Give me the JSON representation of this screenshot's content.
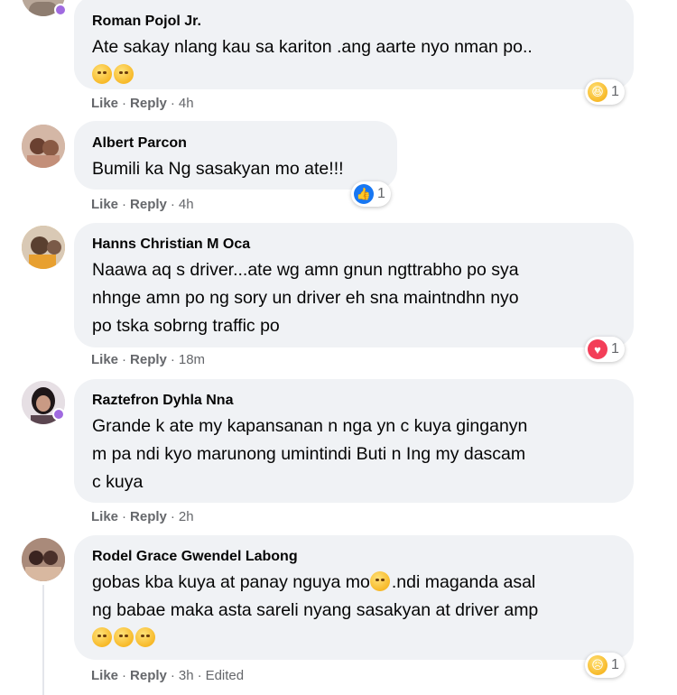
{
  "comments": [
    {
      "author": "Roman Pojol Jr.",
      "text": "Ate sakay nlang kau sa kariton .ang aarte nyo nman po..",
      "emojis": [
        "pensive-emoji",
        "pensive-emoji"
      ],
      "like": "Like",
      "reply": "Reply",
      "time": "4h",
      "reaction": {
        "icon": "haha-icon",
        "count": "1"
      }
    },
    {
      "author": "Albert Parcon",
      "text": "Bumili ka Ng sasakyan mo ate!!!",
      "like": "Like",
      "reply": "Reply",
      "time": "4h",
      "reaction": {
        "icon": "like-icon",
        "count": "1"
      }
    },
    {
      "author": "Hanns Christian M Oca",
      "text": "Naawa aq s driver...ate wg amn gnun ngttrabho po sya\nnhnge amn po ng sory un driver eh sna maintndhn nyo\npo tska sobrng traffic po",
      "like": "Like",
      "reply": "Reply",
      "time": "18m",
      "reaction": {
        "icon": "love-icon",
        "count": "1"
      }
    },
    {
      "author": "Raztefron Dyhla Nna",
      "text": "Grande k ate my kapansanan n nga yn c kuya ginganyn\nm pa ndi kyo marunong umintindi Buti n Ing my dascam\nc kuya",
      "like": "Like",
      "reply": "Reply",
      "time": "2h"
    },
    {
      "author": "Rodel Grace Gwendel Labong",
      "text_a": "gobas kba kuya at panay nguya mo",
      "text_b": ".ndi maganda asal\nng babae maka asta sareli nyang sasakyan at driver amp",
      "emojis": [
        "grin-emoji",
        "grin-emoji",
        "blush-emoji"
      ],
      "like": "Like",
      "reply": "Reply",
      "time": "3h",
      "edited": "Edited",
      "reaction": {
        "icon": "sad-icon",
        "count": "1"
      }
    }
  ],
  "colors": {
    "bubble": "#f0f2f5",
    "meta": "#65676b",
    "like_blue": "#1877f2",
    "love_red": "#f33e58"
  }
}
